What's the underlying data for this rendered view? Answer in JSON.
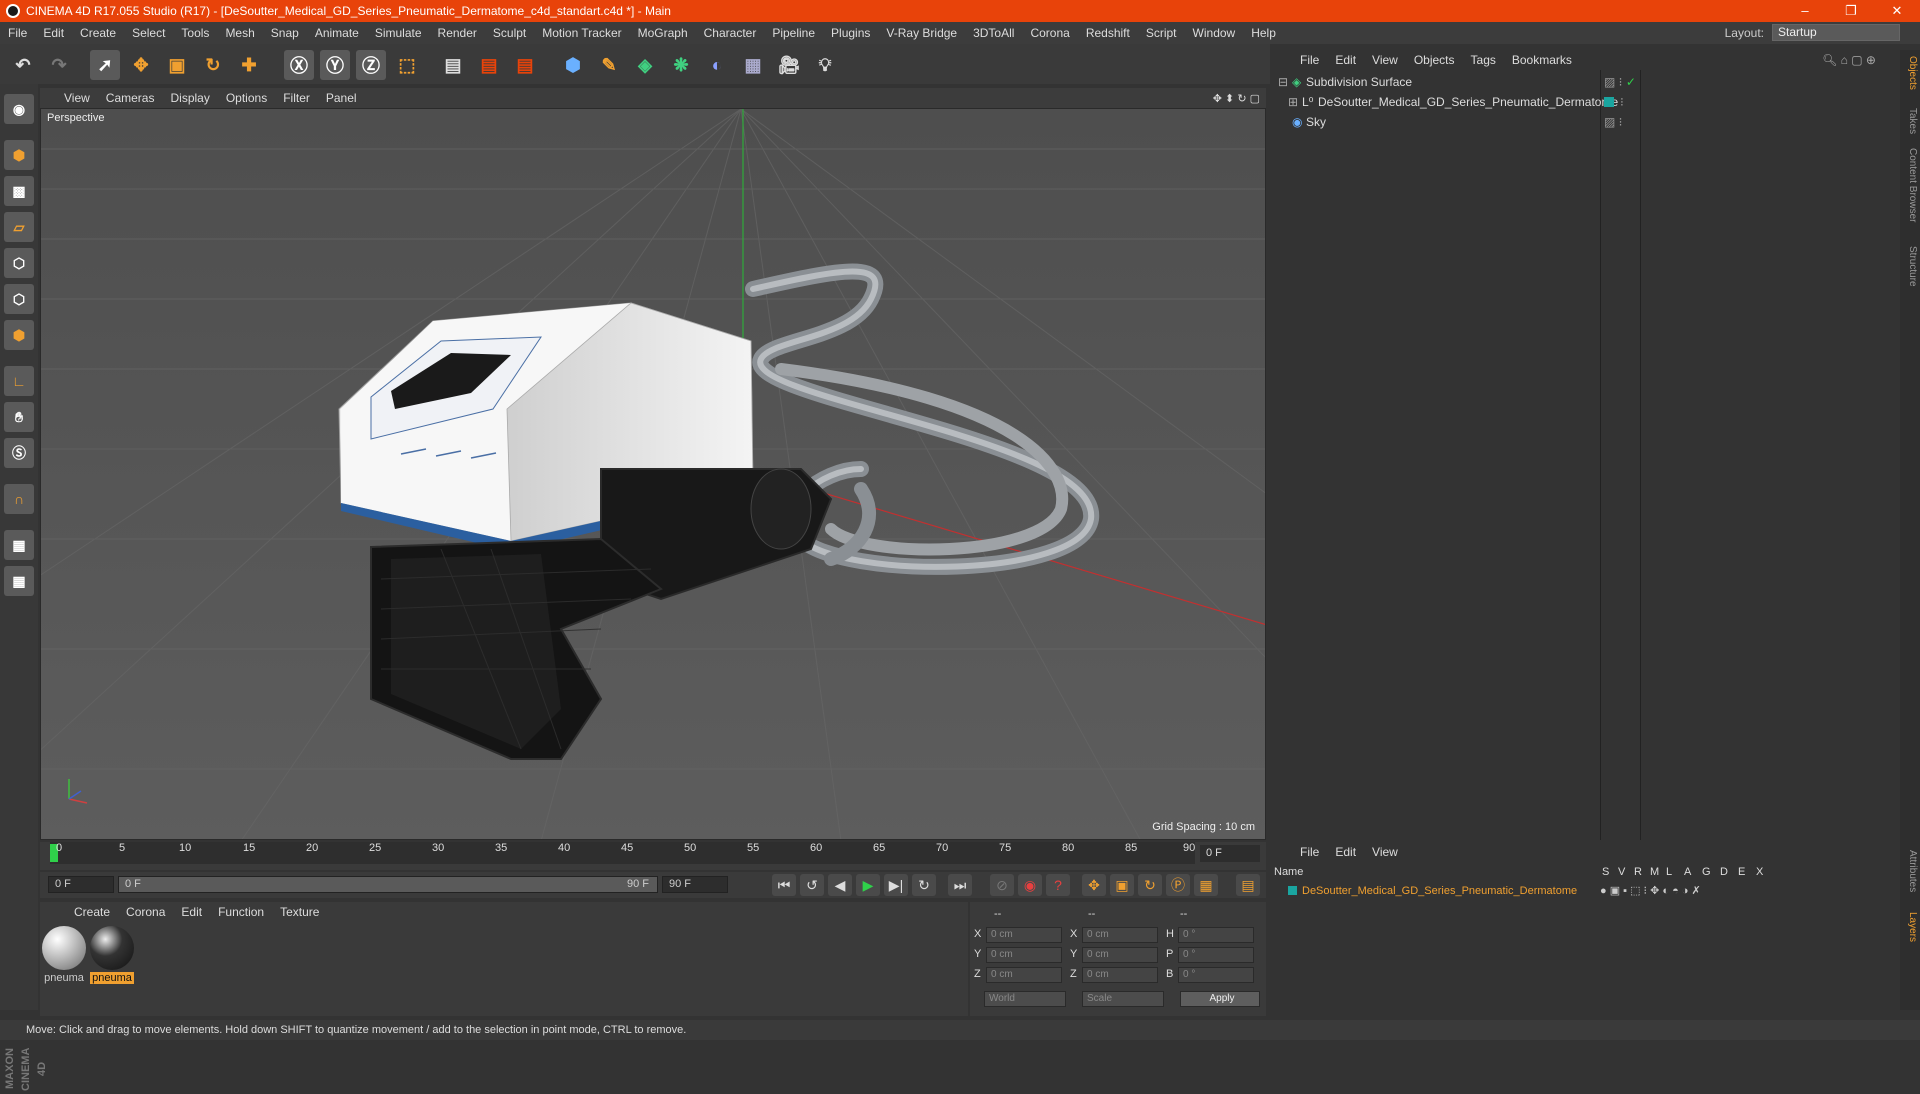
{
  "title": "CINEMA 4D R17.055 Studio (R17) - [DeSoutter_Medical_GD_Series_Pneumatic_Dermatome_c4d_standart.c4d *] - Main",
  "window_controls": [
    "–",
    "❐",
    "✕"
  ],
  "menu": [
    "File",
    "Edit",
    "Create",
    "Select",
    "Tools",
    "Mesh",
    "Snap",
    "Animate",
    "Simulate",
    "Render",
    "Sculpt",
    "Motion Tracker",
    "MoGraph",
    "Character",
    "Pipeline",
    "Plugins",
    "V-Ray Bridge",
    "3DToAll",
    "Corona",
    "Redshift",
    "Script",
    "Window",
    "Help"
  ],
  "layout": {
    "label": "Layout:",
    "value": "Startup"
  },
  "viewport": {
    "menu": [
      "View",
      "Cameras",
      "Display",
      "Options",
      "Filter",
      "Panel"
    ],
    "label": "Perspective",
    "grid_spacing": "Grid Spacing : 10 cm"
  },
  "timeline": {
    "ticks": [
      "0",
      "5",
      "10",
      "15",
      "20",
      "25",
      "30",
      "35",
      "40",
      "45",
      "50",
      "55",
      "60",
      "65",
      "70",
      "75",
      "80",
      "85",
      "90"
    ],
    "current_frame": "0 F",
    "start": "0 F",
    "range_start": "0 F",
    "range_end": "90 F",
    "end": "90 F"
  },
  "materials": {
    "menu": [
      "Create",
      "Corona",
      "Edit",
      "Function",
      "Texture"
    ],
    "items": [
      {
        "label": "pneuma"
      },
      {
        "label": "pneuma"
      }
    ]
  },
  "coords": {
    "headers": [
      "--",
      "--",
      "--"
    ],
    "rows": [
      {
        "a": "X",
        "av": "0 cm",
        "b": "X",
        "bv": "0 cm",
        "c": "H",
        "cv": "0 °"
      },
      {
        "a": "Y",
        "av": "0 cm",
        "b": "Y",
        "bv": "0 cm",
        "c": "P",
        "cv": "0 °"
      },
      {
        "a": "Z",
        "av": "0 cm",
        "b": "Z",
        "bv": "0 cm",
        "c": "B",
        "cv": "0 °"
      }
    ],
    "world": "World",
    "scale": "Scale",
    "apply": "Apply"
  },
  "objects": {
    "menu": [
      "File",
      "Edit",
      "View",
      "Objects",
      "Tags",
      "Bookmarks"
    ],
    "items": [
      {
        "name": "Subdivision Surface"
      },
      {
        "name": "DeSoutter_Medical_GD_Series_Pneumatic_Dermatome"
      },
      {
        "name": "Sky"
      }
    ]
  },
  "layers": {
    "menu": [
      "File",
      "Edit",
      "View"
    ],
    "header_name": "Name",
    "columns": [
      "S",
      "V",
      "R",
      "M",
      "L",
      "A",
      "G",
      "D",
      "E",
      "X"
    ],
    "row": "DeSoutter_Medical_GD_Series_Pneumatic_Dermatome"
  },
  "side_tabs": [
    "Objects",
    "Takes",
    "Content Browser",
    "Structure",
    "Attributes",
    "Layers"
  ],
  "maxon": "MAXON CINEMA 4D",
  "status": "Move: Click and drag to move elements. Hold down SHIFT to quantize movement / add to the selection in point mode, CTRL to remove.",
  "colors": {
    "titlebar": "#e8430a",
    "accent": "#f0a030",
    "object_teal": "#1aa5a0"
  }
}
